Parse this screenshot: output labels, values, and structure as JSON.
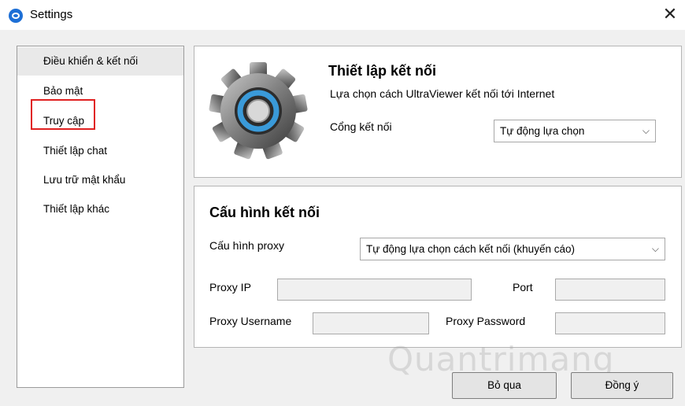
{
  "window": {
    "title": "Settings",
    "close_glyph": "✕"
  },
  "sidebar": {
    "items": [
      {
        "label": "Điều khiển & kết nối"
      },
      {
        "label": "Bảo mật"
      },
      {
        "label": "Truy cập"
      },
      {
        "label": "Thiết lập chat"
      },
      {
        "label": "Lưu trữ mật khẩu"
      },
      {
        "label": "Thiết lập khác"
      }
    ]
  },
  "connection": {
    "title": "Thiết lập kết nối",
    "description": "Lựa chọn cách UltraViewer kết nối tới Internet",
    "port_label": "Cổng kết nối",
    "port_value": "Tự động lựa chọn"
  },
  "config": {
    "title": "Cấu hình kết nối",
    "proxy_label": "Cấu hình proxy",
    "proxy_value": "Tự động lựa chọn cách kết nối (khuyến cáo)",
    "proxy_ip_label": "Proxy IP",
    "proxy_ip_value": "",
    "port_label": "Port",
    "port_value": "",
    "username_label": "Proxy Username",
    "username_value": "",
    "password_label": "Proxy Password",
    "password_value": ""
  },
  "buttons": {
    "cancel": "Bỏ qua",
    "ok": "Đồng ý"
  },
  "watermark": "Quantrimang",
  "colors": {
    "accent": "#1d6fd6",
    "highlight": "#e02020",
    "gear_ring": "#3a9ad9"
  }
}
